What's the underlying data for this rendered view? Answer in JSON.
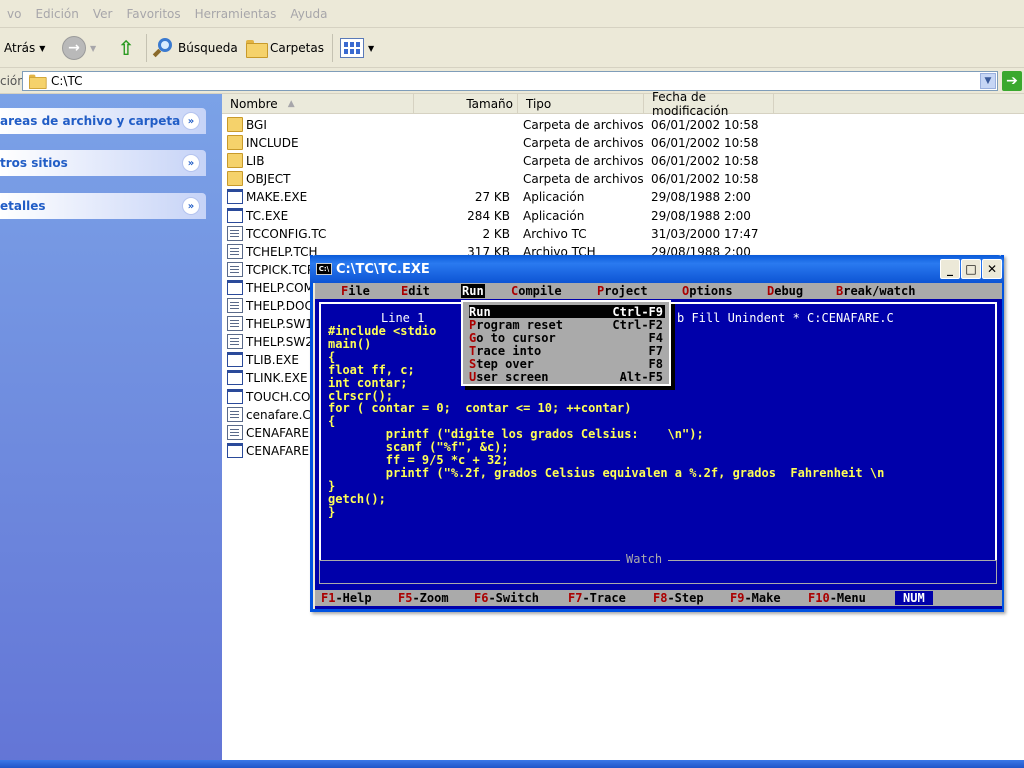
{
  "menubar": [
    "vo",
    "Edición",
    "Ver",
    "Favoritos",
    "Herramientas",
    "Ayuda"
  ],
  "toolbar": {
    "back_label": "Atrás",
    "search_label": "Búsqueda",
    "folders_label": "Carpetas"
  },
  "address": {
    "label": "ción",
    "value": "C:\\TC"
  },
  "taskpane": {
    "sections": [
      "areas de archivo y carpeta",
      "tros sitios",
      "etalles"
    ]
  },
  "filelist": {
    "columns": [
      "Nombre",
      "Tamaño",
      "Tipo",
      "Fecha de modificación"
    ],
    "rows": [
      {
        "name": "BGI",
        "size": "",
        "type": "Carpeta de archivos",
        "date": "06/01/2002 10:58",
        "icon": "folder"
      },
      {
        "name": "INCLUDE",
        "size": "",
        "type": "Carpeta de archivos",
        "date": "06/01/2002 10:58",
        "icon": "folder"
      },
      {
        "name": "LIB",
        "size": "",
        "type": "Carpeta de archivos",
        "date": "06/01/2002 10:58",
        "icon": "folder"
      },
      {
        "name": "OBJECT",
        "size": "",
        "type": "Carpeta de archivos",
        "date": "06/01/2002 10:58",
        "icon": "folder"
      },
      {
        "name": "MAKE.EXE",
        "size": "27 KB",
        "type": "Aplicación",
        "date": "29/08/1988 2:00",
        "icon": "exe"
      },
      {
        "name": "TC.EXE",
        "size": "284 KB",
        "type": "Aplicación",
        "date": "29/08/1988 2:00",
        "icon": "exe"
      },
      {
        "name": "TCCONFIG.TC",
        "size": "2 KB",
        "type": "Archivo TC",
        "date": "31/03/2000 17:47",
        "icon": "doc"
      },
      {
        "name": "TCHELP.TCH",
        "size": "317 KB",
        "type": "Archivo TCH",
        "date": "29/08/1988 2:00",
        "icon": "doc"
      },
      {
        "name": "TCPICK.TCP",
        "size": "",
        "type": "",
        "date": "",
        "icon": "doc"
      },
      {
        "name": "THELP.COM",
        "size": "",
        "type": "",
        "date": "",
        "icon": "exe"
      },
      {
        "name": "THELP.DOC",
        "size": "",
        "type": "",
        "date": "",
        "icon": "doc"
      },
      {
        "name": "THELP.SW1",
        "size": "",
        "type": "",
        "date": "",
        "icon": "doc"
      },
      {
        "name": "THELP.SW2",
        "size": "",
        "type": "",
        "date": "",
        "icon": "doc"
      },
      {
        "name": "TLIB.EXE",
        "size": "",
        "type": "",
        "date": "",
        "icon": "exe"
      },
      {
        "name": "TLINK.EXE",
        "size": "",
        "type": "",
        "date": "",
        "icon": "exe"
      },
      {
        "name": "TOUCH.COM",
        "size": "",
        "type": "",
        "date": "",
        "icon": "exe"
      },
      {
        "name": "cenafare.C",
        "size": "",
        "type": "",
        "date": "",
        "icon": "doc"
      },
      {
        "name": "CENAFARE.(",
        "size": "",
        "type": "",
        "date": "",
        "icon": "doc"
      },
      {
        "name": "CENAFARE.I",
        "size": "",
        "type": "",
        "date": "",
        "icon": "exe"
      }
    ]
  },
  "tc": {
    "title": "C:\\TC\\TC.EXE",
    "sys_icon": "C:\\",
    "menu": [
      {
        "hk": "F",
        "rest": "ile"
      },
      {
        "hk": "E",
        "rest": "dit"
      },
      {
        "hk": "R",
        "rest": "un"
      },
      {
        "hk": "C",
        "rest": "ompile"
      },
      {
        "hk": "P",
        "rest": "roject"
      },
      {
        "hk": "O",
        "rest": "ptions"
      },
      {
        "hk": "D",
        "rest": "ebug"
      },
      {
        "hk": "B",
        "rest": "reak/watch"
      }
    ],
    "editor_line": "Line 1",
    "editor_status": "b Fill Unindent * C:CENAFARE.C",
    "code": [
      "#include <stdio",
      "main()",
      "{",
      "float ff, c;",
      "int contar;",
      "clrscr();",
      "for ( contar = 0;  contar <= 10; ++contar)",
      "{",
      "        printf (\"digite los grados Celsius:    \\n\");",
      "        scanf (\"%f\", &c);",
      "        ff = 9/5 *c + 32;",
      "        printf (\"%.2f, grados Celsius equivalen a %.2f, grados  Fahrenheit \\n",
      "}",
      "getch();",
      "}"
    ],
    "watch_label": "Watch",
    "run_menu": [
      {
        "hk": "R",
        "rest": "un",
        "shortcut": "Ctrl-F9"
      },
      {
        "hk": "P",
        "rest": "rogram reset",
        "shortcut": "Ctrl-F2"
      },
      {
        "hk": "G",
        "rest": "o to cursor",
        "shortcut": "F4"
      },
      {
        "hk": "T",
        "rest": "race into",
        "shortcut": "F7"
      },
      {
        "hk": "S",
        "rest": "tep over",
        "shortcut": "F8"
      },
      {
        "hk": "U",
        "rest": "ser screen",
        "shortcut": "Alt-F5"
      }
    ],
    "status": [
      {
        "key": "F1",
        "label": "-Help"
      },
      {
        "key": "F5",
        "label": "-Zoom"
      },
      {
        "key": "F6",
        "label": "-Switch"
      },
      {
        "key": "F7",
        "label": "-Trace"
      },
      {
        "key": "F8",
        "label": "-Step"
      },
      {
        "key": "F9",
        "label": "-Make"
      },
      {
        "key": "F10",
        "label": "-Menu"
      }
    ],
    "num": "NUM"
  }
}
